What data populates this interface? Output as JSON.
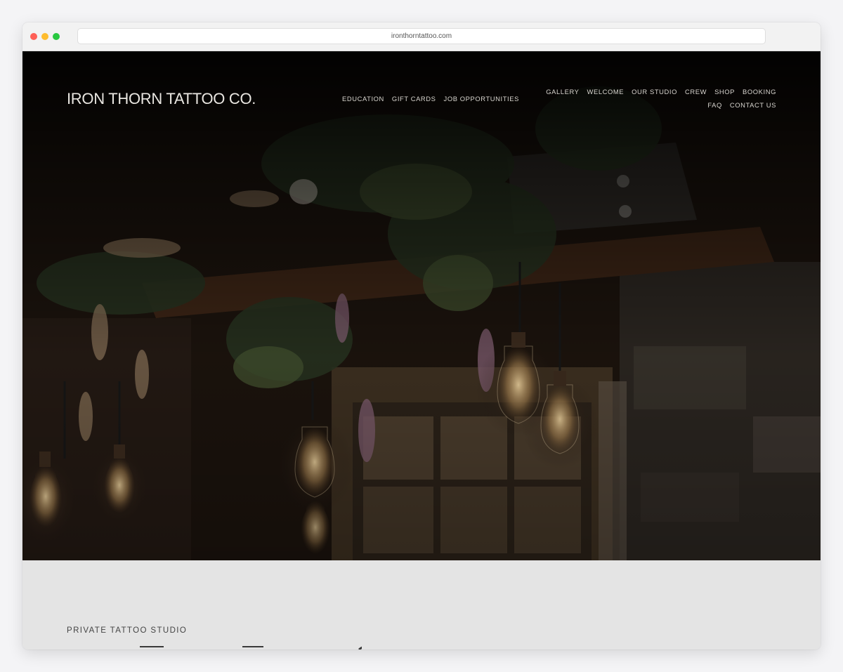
{
  "browser": {
    "url": "ironthorntattoo.com"
  },
  "site": {
    "logo": "IRON THORN TATTOO CO.",
    "nav_left": [
      "EDUCATION",
      "GIFT CARDS",
      "JOB OPPORTUNITIES"
    ],
    "nav_right_row1": [
      "GALLERY",
      "WELCOME",
      "OUR STUDIO",
      "CREW",
      "SHOP",
      "BOOKING"
    ],
    "nav_right_row2": [
      "FAQ",
      "CONTACT US"
    ]
  },
  "section": {
    "eyebrow": "PRIVATE TATTOO STUDIO"
  },
  "colors": {
    "hero_overlay": "#0e0907",
    "bulb_glow": "#c9a774",
    "foliage": "#27321f",
    "section_bg": "#e4e4e4"
  }
}
